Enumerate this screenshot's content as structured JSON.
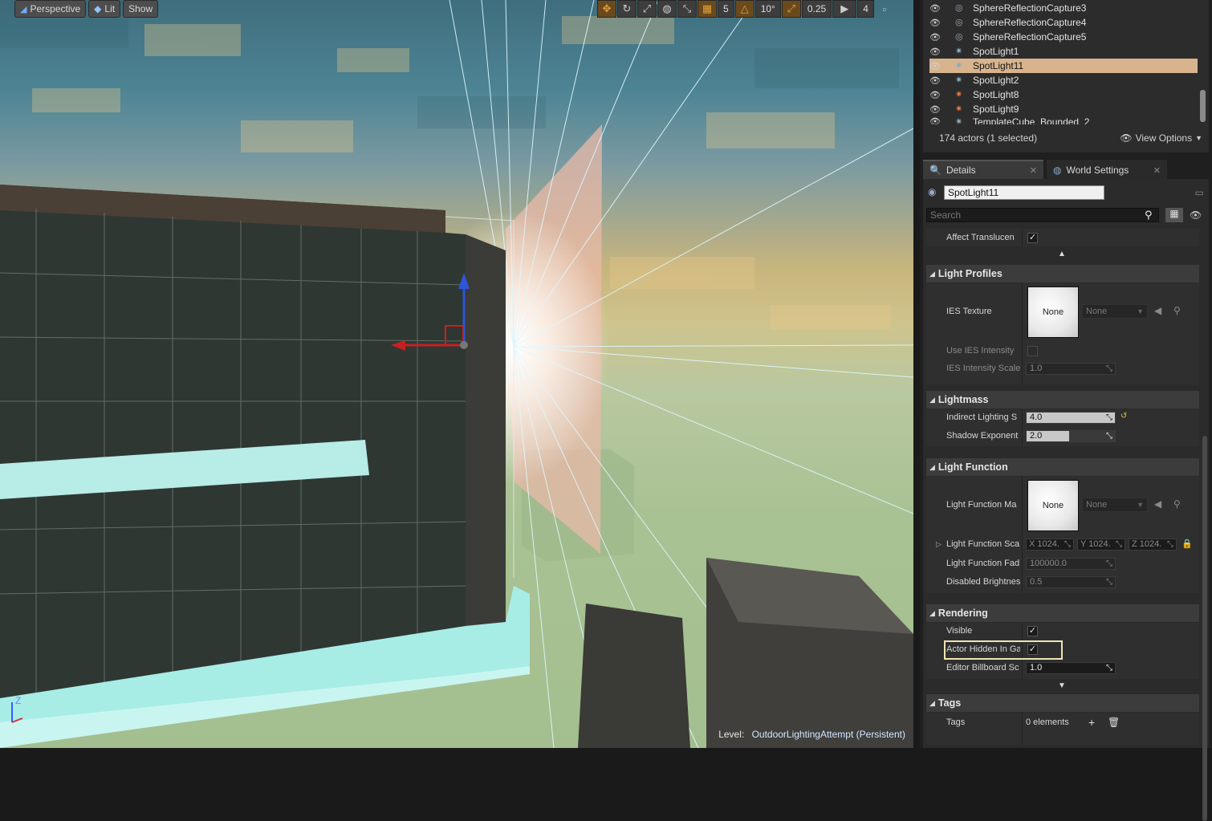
{
  "viewport": {
    "perspective_label": "Perspective",
    "lit_label": "Lit",
    "show_label": "Show",
    "grid_value": "5",
    "angle_value": "10°",
    "scale_value": "0.25",
    "camera_speed": "4",
    "level_prefix": "Level:",
    "level_name": "OutdoorLightingAttempt (Persistent)",
    "axis_label": "Z"
  },
  "outliner": {
    "items": [
      {
        "label": "SphereReflectionCapture3"
      },
      {
        "label": "SphereReflectionCapture4"
      },
      {
        "label": "SphereReflectionCapture5"
      },
      {
        "label": "SpotLight1"
      },
      {
        "label": "SpotLight11"
      },
      {
        "label": "SpotLight2"
      },
      {
        "label": "SpotLight8"
      },
      {
        "label": "SpotLight9"
      },
      {
        "label": "TemplateCube_Bounded_2"
      }
    ],
    "actor_count": "174 actors (1 selected)",
    "view_options": "View Options"
  },
  "tabs": {
    "details": "Details",
    "world_settings": "World Settings"
  },
  "details": {
    "actor_name": "SpotLight11",
    "search_placeholder": "Search",
    "affect_translucent": "Affect Translucen",
    "light_profiles": {
      "title": "Light Profiles",
      "ies_texture": "IES Texture",
      "thumb_label": "None",
      "combo_value": "None",
      "use_ies_intensity": "Use IES Intensity",
      "ies_intensity_scale": "IES Intensity Scale",
      "ies_intensity_value": "1.0"
    },
    "lightmass": {
      "title": "Lightmass",
      "indirect_label": "Indirect Lighting S",
      "indirect_value": "4.0",
      "shadow_label": "Shadow Exponent",
      "shadow_value": "2.0"
    },
    "light_function": {
      "title": "Light Function",
      "material_label": "Light Function Ma",
      "thumb_label": "None",
      "combo_value": "None",
      "scale_label": "Light Function Sca",
      "x_value": "X  1024.",
      "y_value": "Y  1024.",
      "z_value": "Z  1024.",
      "fade_label": "Light Function Fad",
      "fade_value": "100000.0",
      "disabled_label": "Disabled Brightnes",
      "disabled_value": "0.5"
    },
    "rendering": {
      "title": "Rendering",
      "visible_label": "Visible",
      "hidden_label": "Actor Hidden In Ga",
      "billboard_label": "Editor Billboard Sc",
      "billboard_value": "1.0"
    },
    "tags": {
      "title": "Tags",
      "tags_label": "Tags",
      "count": "0 elements"
    }
  },
  "colors": {
    "selection": "#d8b48e",
    "highlight_border": "#efe3b3",
    "accent_orange": "#e0a040"
  }
}
